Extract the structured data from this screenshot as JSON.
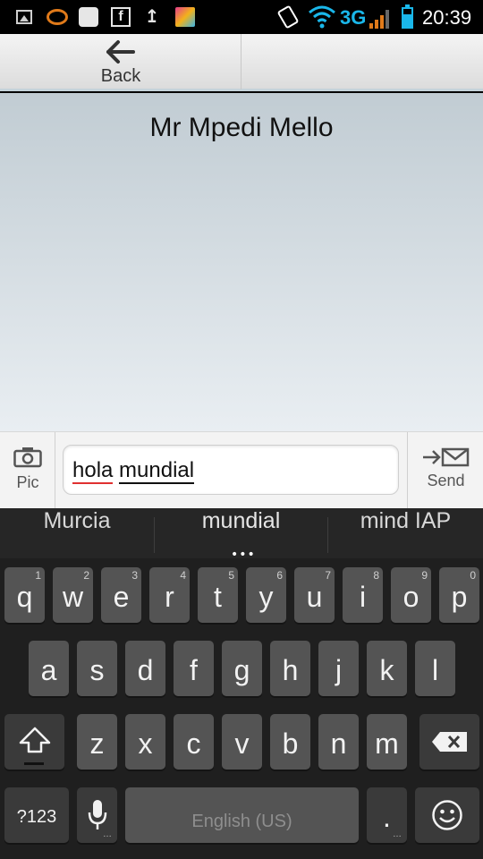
{
  "status_bar": {
    "network": "3G",
    "time": "20:39"
  },
  "header": {
    "back_label": "Back"
  },
  "conversation": {
    "contact_name": "Mr Mpedi Mello"
  },
  "compose": {
    "pic_label": "Pic",
    "message_word_1": "hola",
    "message_word_2": "mundial",
    "send_label": "Send"
  },
  "keyboard": {
    "suggestions": [
      "Murcia",
      "mundial",
      "mind IAP"
    ],
    "row1": [
      {
        "key": "q",
        "hint": "1"
      },
      {
        "key": "w",
        "hint": "2"
      },
      {
        "key": "e",
        "hint": "3"
      },
      {
        "key": "r",
        "hint": "4"
      },
      {
        "key": "t",
        "hint": "5"
      },
      {
        "key": "y",
        "hint": "6"
      },
      {
        "key": "u",
        "hint": "7"
      },
      {
        "key": "i",
        "hint": "8"
      },
      {
        "key": "o",
        "hint": "9"
      },
      {
        "key": "p",
        "hint": "0"
      }
    ],
    "row2": [
      "a",
      "s",
      "d",
      "f",
      "g",
      "h",
      "j",
      "k",
      "l"
    ],
    "row3": [
      "z",
      "x",
      "c",
      "v",
      "b",
      "n",
      "m"
    ],
    "symbols_key": "?123",
    "space_label": "English (US)",
    "period_key": "."
  }
}
